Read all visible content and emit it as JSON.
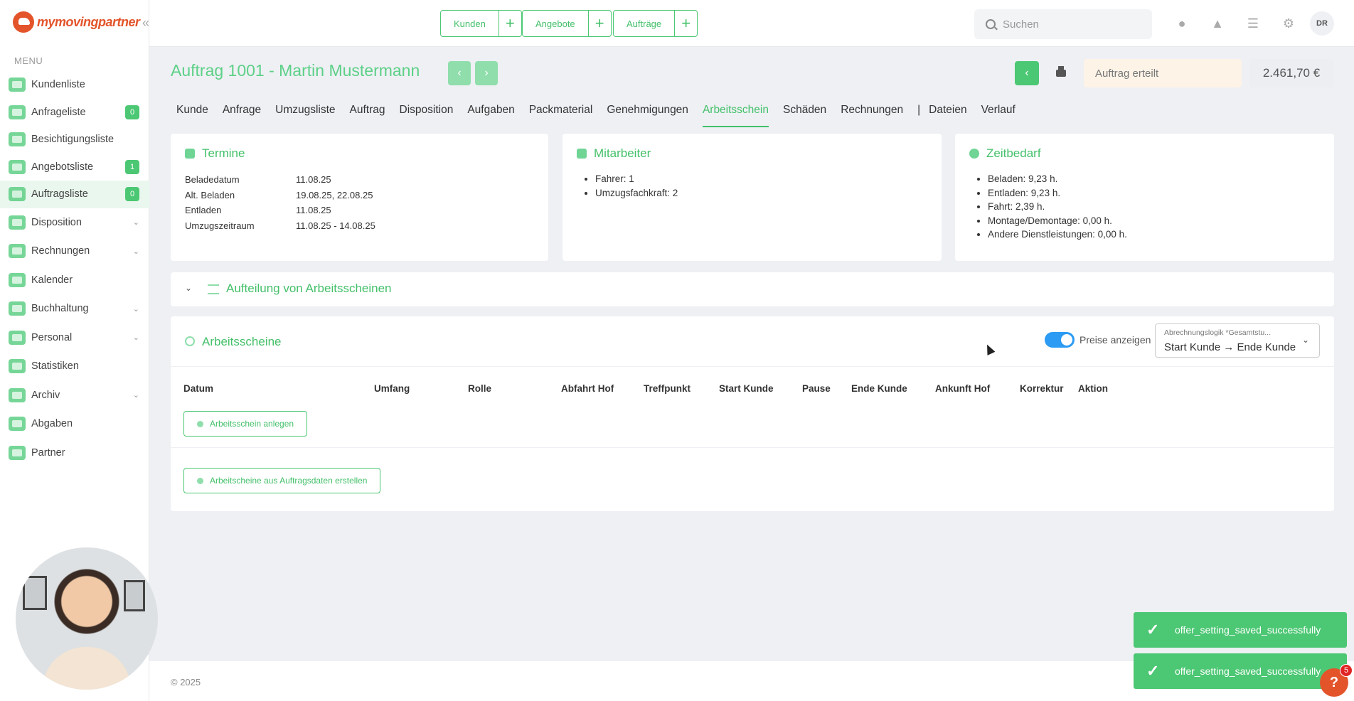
{
  "brand": {
    "logo_text": "mymovingpartner"
  },
  "sidebar": {
    "menu_label": "MENU",
    "items": [
      {
        "label": "Kundenliste",
        "icon": "users-icon"
      },
      {
        "label": "Anfrageliste",
        "icon": "inbox-icon",
        "badge": "0"
      },
      {
        "label": "Besichtigungsliste",
        "icon": "house-icon"
      },
      {
        "label": "Angebotsliste",
        "icon": "document-icon",
        "badge": "1"
      },
      {
        "label": "Auftragsliste",
        "icon": "clipboard-icon",
        "badge": "0",
        "active": true
      },
      {
        "label": "Disposition",
        "icon": "disposition-icon",
        "expandable": true
      },
      {
        "label": "Rechnungen",
        "icon": "money-icon",
        "expandable": true
      },
      {
        "label": "Kalender",
        "icon": "calendar-icon"
      },
      {
        "label": "Buchhaltung",
        "icon": "accounting-icon",
        "expandable": true
      },
      {
        "label": "Personal",
        "icon": "person-icon",
        "expandable": true
      },
      {
        "label": "Statistiken",
        "icon": "stats-icon"
      },
      {
        "label": "Archiv",
        "icon": "archive-icon",
        "expandable": true
      },
      {
        "label": "Abgaben",
        "icon": "network-icon"
      },
      {
        "label": "Partner",
        "icon": "handshake-icon"
      }
    ]
  },
  "topbar": {
    "quick": [
      {
        "label": "Kunden"
      },
      {
        "label": "Angebote"
      },
      {
        "label": "Aufträge"
      }
    ],
    "search_placeholder": "Suchen",
    "avatar_initials": "DR"
  },
  "header": {
    "title": "Auftrag 1001 - Martin Mustermann",
    "status": "Auftrag erteilt",
    "price": "2.461,70 €"
  },
  "tabs": [
    "Kunde",
    "Anfrage",
    "Umzugsliste",
    "Auftrag",
    "Disposition",
    "Aufgaben",
    "Packmaterial",
    "Genehmigungen",
    "Arbeitsschein",
    "Schäden",
    "Rechnungen",
    "|",
    "Dateien",
    "Verlauf"
  ],
  "active_tab": "Arbeitsschein",
  "termine": {
    "title": "Termine",
    "rows": [
      {
        "k": "Beladedatum",
        "v": "11.08.25"
      },
      {
        "k": "Alt. Beladen",
        "v": "19.08.25, 22.08.25"
      },
      {
        "k": "Entladen",
        "v": "11.08.25"
      },
      {
        "k": "Umzugszeitraum",
        "v": "11.08.25 - 14.08.25"
      }
    ]
  },
  "mitarbeiter": {
    "title": "Mitarbeiter",
    "items": [
      "Fahrer: 1",
      "Umzugsfachkraft: 2"
    ]
  },
  "zeitbedarf": {
    "title": "Zeitbedarf",
    "items": [
      "Beladen: 9,23 h.",
      "Entladen: 9,23 h.",
      "Fahrt: 2,39 h.",
      "Montage/Demontage: 0,00 h.",
      "Andere Dienstleistungen: 0,00 h."
    ]
  },
  "aufteilung": {
    "title": "Aufteilung von Arbeitsscheinen"
  },
  "arbeitsscheine": {
    "title": "Arbeitsscheine",
    "toggle_label": "Preise anzeigen",
    "toggle_on": true,
    "select_placeholder": "Abrechnungslogik *Gesamtstu...",
    "select_value": "Start Kunde → Ende Kunde",
    "columns": [
      "Datum",
      "Umfang",
      "Rolle",
      "Abfahrt Hof",
      "Treffpunkt",
      "Start Kunde",
      "Pause",
      "Ende Kunde",
      "Ankunft Hof",
      "Korrektur",
      "Aktion"
    ],
    "add_button": "Arbeitsschein anlegen",
    "create_button": "Arbeitscheine aus Auftragsdaten erstellen"
  },
  "footer": {
    "copyright": "© 2025"
  },
  "toasts": [
    "offer_setting_saved_successfully",
    "offer_setting_saved_successfully"
  ],
  "help": {
    "label": "?",
    "badge": "5"
  },
  "colors": {
    "accent": "#4cc773",
    "brand": "#e3542b",
    "toggle": "#2b9bf4"
  }
}
